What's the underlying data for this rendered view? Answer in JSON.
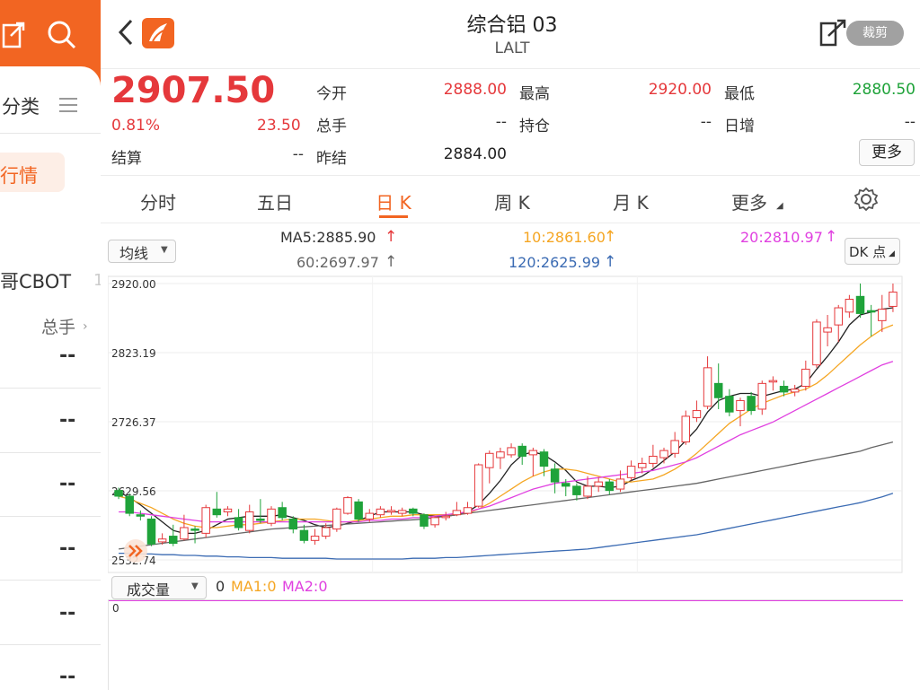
{
  "left_panel": {
    "category_label": "分类",
    "quote_label": "行情",
    "cbot_label": "哥CBOT",
    "volume_label": "总手",
    "dash_values": [
      "--",
      "--",
      "--",
      "--",
      "--",
      "--"
    ]
  },
  "header": {
    "title": "综合铝 03",
    "code": "LALT",
    "crop_label": "裁剪"
  },
  "quote": {
    "price": "2907.50",
    "change_pct": "0.81%",
    "change_amt": "23.50",
    "settle_label": "结算",
    "settle_value": "--",
    "open_label": "今开",
    "open_value": "2888.00",
    "high_label": "最高",
    "high_value": "2920.00",
    "low_label": "最低",
    "low_value": "2880.50",
    "volume_label": "总手",
    "volume_value": "--",
    "position_label": "持仓",
    "position_value": "--",
    "daily_inc_label": "日增",
    "daily_inc_value": "--",
    "prev_settle_label": "昨结",
    "prev_settle_value": "2884.00",
    "more_label": "更多"
  },
  "tabs": [
    {
      "label": "分时",
      "active": false
    },
    {
      "label": "五日",
      "active": false
    },
    {
      "label": "日 K",
      "active": true
    },
    {
      "label": "周 K",
      "active": false
    },
    {
      "label": "月 K",
      "active": false
    },
    {
      "label": "更多",
      "active": false
    }
  ],
  "indicator": {
    "ma_select": "均线",
    "ma5": "MA5:2885.90",
    "ma10": "10:2861.60",
    "ma20": "20:2810.97",
    "ma60": "60:2697.97",
    "ma120": "120:2625.99",
    "dk_label": "DK 点"
  },
  "volume_panel": {
    "select_label": "成交量",
    "value": "0",
    "ma1": "MA1:0",
    "ma2": "MA2:0",
    "axis_zero": "0"
  },
  "colors": {
    "up": "#e5383b",
    "down": "#1fa33a",
    "brand": "#f26522",
    "ma5": "#222222",
    "ma10": "#f5a623",
    "ma20": "#e040e0",
    "ma60": "#666666",
    "ma120": "#3b6bb3"
  },
  "chart_data": {
    "type": "candlestick",
    "y_ticks": [
      "2920.00",
      "2823.19",
      "2726.37",
      "2629.56",
      "2532.74"
    ],
    "ylim": [
      2532.74,
      2920.0
    ],
    "grid": true,
    "candles": [
      {
        "o": 2630,
        "c": 2622,
        "h": 2634,
        "l": 2618
      },
      {
        "o": 2622,
        "c": 2598,
        "h": 2626,
        "l": 2594
      },
      {
        "o": 2596,
        "c": 2594,
        "h": 2602,
        "l": 2588
      },
      {
        "o": 2590,
        "c": 2555,
        "h": 2594,
        "l": 2552
      },
      {
        "o": 2558,
        "c": 2562,
        "h": 2570,
        "l": 2554
      },
      {
        "o": 2566,
        "c": 2556,
        "h": 2582,
        "l": 2552
      },
      {
        "o": 2562,
        "c": 2578,
        "h": 2596,
        "l": 2560
      },
      {
        "o": 2576,
        "c": 2575,
        "h": 2580,
        "l": 2556
      },
      {
        "o": 2570,
        "c": 2606,
        "h": 2610,
        "l": 2564
      },
      {
        "o": 2604,
        "c": 2596,
        "h": 2628,
        "l": 2592
      },
      {
        "o": 2600,
        "c": 2604,
        "h": 2608,
        "l": 2594
      },
      {
        "o": 2592,
        "c": 2578,
        "h": 2604,
        "l": 2574
      },
      {
        "o": 2574,
        "c": 2600,
        "h": 2610,
        "l": 2570
      },
      {
        "o": 2590,
        "c": 2588,
        "h": 2618,
        "l": 2584
      },
      {
        "o": 2584,
        "c": 2604,
        "h": 2608,
        "l": 2580
      },
      {
        "o": 2606,
        "c": 2592,
        "h": 2614,
        "l": 2588
      },
      {
        "o": 2590,
        "c": 2576,
        "h": 2594,
        "l": 2570
      },
      {
        "o": 2574,
        "c": 2560,
        "h": 2582,
        "l": 2556
      },
      {
        "o": 2560,
        "c": 2566,
        "h": 2576,
        "l": 2554
      },
      {
        "o": 2566,
        "c": 2578,
        "h": 2584,
        "l": 2562
      },
      {
        "o": 2576,
        "c": 2604,
        "h": 2606,
        "l": 2572
      },
      {
        "o": 2598,
        "c": 2620,
        "h": 2622,
        "l": 2596
      },
      {
        "o": 2614,
        "c": 2590,
        "h": 2618,
        "l": 2586
      },
      {
        "o": 2590,
        "c": 2598,
        "h": 2604,
        "l": 2586
      },
      {
        "o": 2596,
        "c": 2604,
        "h": 2608,
        "l": 2592
      },
      {
        "o": 2600,
        "c": 2602,
        "h": 2608,
        "l": 2596
      },
      {
        "o": 2598,
        "c": 2602,
        "h": 2606,
        "l": 2594
      },
      {
        "o": 2604,
        "c": 2598,
        "h": 2606,
        "l": 2594
      },
      {
        "o": 2596,
        "c": 2580,
        "h": 2598,
        "l": 2576
      },
      {
        "o": 2582,
        "c": 2592,
        "h": 2594,
        "l": 2578
      },
      {
        "o": 2592,
        "c": 2594,
        "h": 2600,
        "l": 2588
      },
      {
        "o": 2596,
        "c": 2602,
        "h": 2614,
        "l": 2594
      },
      {
        "o": 2598,
        "c": 2606,
        "h": 2614,
        "l": 2596
      },
      {
        "o": 2608,
        "c": 2666,
        "h": 2668,
        "l": 2606
      },
      {
        "o": 2662,
        "c": 2682,
        "h": 2686,
        "l": 2640
      },
      {
        "o": 2676,
        "c": 2684,
        "h": 2690,
        "l": 2660
      },
      {
        "o": 2680,
        "c": 2690,
        "h": 2696,
        "l": 2676
      },
      {
        "o": 2692,
        "c": 2678,
        "h": 2696,
        "l": 2666
      },
      {
        "o": 2680,
        "c": 2686,
        "h": 2690,
        "l": 2650
      },
      {
        "o": 2684,
        "c": 2664,
        "h": 2688,
        "l": 2650
      },
      {
        "o": 2660,
        "c": 2642,
        "h": 2668,
        "l": 2626
      },
      {
        "o": 2640,
        "c": 2636,
        "h": 2646,
        "l": 2622
      },
      {
        "o": 2636,
        "c": 2624,
        "h": 2640,
        "l": 2616
      },
      {
        "o": 2622,
        "c": 2636,
        "h": 2650,
        "l": 2618
      },
      {
        "o": 2636,
        "c": 2642,
        "h": 2648,
        "l": 2628
      },
      {
        "o": 2642,
        "c": 2630,
        "h": 2646,
        "l": 2624
      },
      {
        "o": 2632,
        "c": 2646,
        "h": 2658,
        "l": 2628
      },
      {
        "o": 2648,
        "c": 2664,
        "h": 2672,
        "l": 2644
      },
      {
        "o": 2662,
        "c": 2668,
        "h": 2676,
        "l": 2654
      },
      {
        "o": 2668,
        "c": 2678,
        "h": 2694,
        "l": 2662
      },
      {
        "o": 2676,
        "c": 2686,
        "h": 2690,
        "l": 2668
      },
      {
        "o": 2682,
        "c": 2700,
        "h": 2712,
        "l": 2676
      },
      {
        "o": 2698,
        "c": 2734,
        "h": 2742,
        "l": 2694
      },
      {
        "o": 2732,
        "c": 2742,
        "h": 2756,
        "l": 2726
      },
      {
        "o": 2748,
        "c": 2802,
        "h": 2818,
        "l": 2744
      },
      {
        "o": 2780,
        "c": 2760,
        "h": 2808,
        "l": 2744
      },
      {
        "o": 2762,
        "c": 2740,
        "h": 2772,
        "l": 2734
      },
      {
        "o": 2742,
        "c": 2756,
        "h": 2760,
        "l": 2720
      },
      {
        "o": 2762,
        "c": 2742,
        "h": 2768,
        "l": 2736
      },
      {
        "o": 2744,
        "c": 2780,
        "h": 2784,
        "l": 2736
      },
      {
        "o": 2782,
        "c": 2784,
        "h": 2790,
        "l": 2770
      },
      {
        "o": 2776,
        "c": 2768,
        "h": 2784,
        "l": 2762
      },
      {
        "o": 2768,
        "c": 2772,
        "h": 2778,
        "l": 2762
      },
      {
        "o": 2776,
        "c": 2800,
        "h": 2812,
        "l": 2770
      },
      {
        "o": 2806,
        "c": 2866,
        "h": 2870,
        "l": 2802
      },
      {
        "o": 2852,
        "c": 2858,
        "h": 2876,
        "l": 2832
      },
      {
        "o": 2862,
        "c": 2886,
        "h": 2890,
        "l": 2838
      },
      {
        "o": 2880,
        "c": 2898,
        "h": 2904,
        "l": 2872
      },
      {
        "o": 2902,
        "c": 2878,
        "h": 2920,
        "l": 2872
      },
      {
        "o": 2882,
        "c": 2880,
        "h": 2890,
        "l": 2846
      },
      {
        "o": 2868,
        "c": 2884,
        "h": 2904,
        "l": 2852
      },
      {
        "o": 2888,
        "c": 2908,
        "h": 2920,
        "l": 2880
      }
    ],
    "ma_series": [
      {
        "name": "MA5",
        "values": [
          2628,
          2620,
          2610,
          2598,
          2586,
          2574,
          2570,
          2570,
          2574,
          2582,
          2590,
          2592,
          2594,
          2594,
          2594,
          2596,
          2592,
          2588,
          2582,
          2578,
          2580,
          2584,
          2588,
          2594,
          2600,
          2600,
          2600,
          2600,
          2596,
          2594,
          2594,
          2596,
          2600,
          2610,
          2626,
          2644,
          2666,
          2680,
          2684,
          2680,
          2670,
          2658,
          2642,
          2636,
          2636,
          2634,
          2636,
          2644,
          2650,
          2660,
          2672,
          2684,
          2700,
          2716,
          2740,
          2756,
          2762,
          2766,
          2766,
          2762,
          2766,
          2770,
          2772,
          2780,
          2800,
          2818,
          2838,
          2862,
          2876,
          2880,
          2884,
          2886
        ]
      },
      {
        "name": "MA10",
        "values": [
          2622,
          2618,
          2612,
          2606,
          2598,
          2590,
          2584,
          2580,
          2578,
          2578,
          2580,
          2582,
          2582,
          2584,
          2586,
          2588,
          2590,
          2590,
          2590,
          2588,
          2586,
          2586,
          2588,
          2590,
          2592,
          2594,
          2594,
          2596,
          2596,
          2596,
          2596,
          2596,
          2598,
          2604,
          2612,
          2622,
          2632,
          2642,
          2650,
          2656,
          2660,
          2660,
          2658,
          2654,
          2650,
          2646,
          2642,
          2642,
          2644,
          2646,
          2652,
          2660,
          2670,
          2682,
          2696,
          2710,
          2724,
          2734,
          2744,
          2752,
          2758,
          2764,
          2768,
          2772,
          2780,
          2792,
          2806,
          2820,
          2834,
          2846,
          2856,
          2862
        ]
      },
      {
        "name": "MA20",
        "values": [
          2600,
          2600,
          2598,
          2596,
          2594,
          2592,
          2590,
          2588,
          2586,
          2586,
          2586,
          2586,
          2586,
          2586,
          2586,
          2586,
          2586,
          2586,
          2586,
          2586,
          2586,
          2586,
          2586,
          2588,
          2588,
          2590,
          2590,
          2592,
          2592,
          2594,
          2596,
          2598,
          2600,
          2604,
          2608,
          2614,
          2620,
          2626,
          2632,
          2636,
          2640,
          2642,
          2644,
          2646,
          2648,
          2650,
          2652,
          2654,
          2656,
          2658,
          2662,
          2666,
          2670,
          2676,
          2684,
          2692,
          2700,
          2708,
          2714,
          2720,
          2726,
          2734,
          2742,
          2750,
          2758,
          2766,
          2774,
          2782,
          2790,
          2798,
          2806,
          2811
        ]
      },
      {
        "name": "MA60",
        "values": [
          2548,
          2550,
          2552,
          2554,
          2556,
          2558,
          2560,
          2562,
          2564,
          2566,
          2568,
          2570,
          2572,
          2574,
          2576,
          2577,
          2578,
          2579,
          2580,
          2581,
          2582,
          2583,
          2584,
          2585,
          2586,
          2587,
          2588,
          2589,
          2590,
          2592,
          2594,
          2596,
          2598,
          2600,
          2602,
          2604,
          2606,
          2608,
          2610,
          2612,
          2614,
          2616,
          2618,
          2620,
          2622,
          2624,
          2626,
          2628,
          2630,
          2632,
          2634,
          2636,
          2638,
          2640,
          2643,
          2646,
          2649,
          2652,
          2655,
          2658,
          2661,
          2664,
          2667,
          2670,
          2673,
          2676,
          2679,
          2682,
          2685,
          2690,
          2694,
          2698
        ]
      },
      {
        "name": "MA120",
        "values": [
          2542,
          2542,
          2541,
          2541,
          2540,
          2540,
          2539,
          2539,
          2538,
          2538,
          2537,
          2537,
          2536,
          2536,
          2536,
          2535,
          2535,
          2535,
          2535,
          2535,
          2534,
          2534,
          2534,
          2534,
          2534,
          2534,
          2534,
          2535,
          2535,
          2535,
          2536,
          2536,
          2537,
          2538,
          2539,
          2540,
          2541,
          2542,
          2543,
          2544,
          2545,
          2546,
          2547,
          2548,
          2550,
          2552,
          2554,
          2556,
          2558,
          2560,
          2562,
          2564,
          2566,
          2568,
          2571,
          2574,
          2577,
          2580,
          2583,
          2586,
          2589,
          2592,
          2595,
          2598,
          2601,
          2604,
          2607,
          2610,
          2613,
          2617,
          2621,
          2626
        ]
      }
    ]
  }
}
